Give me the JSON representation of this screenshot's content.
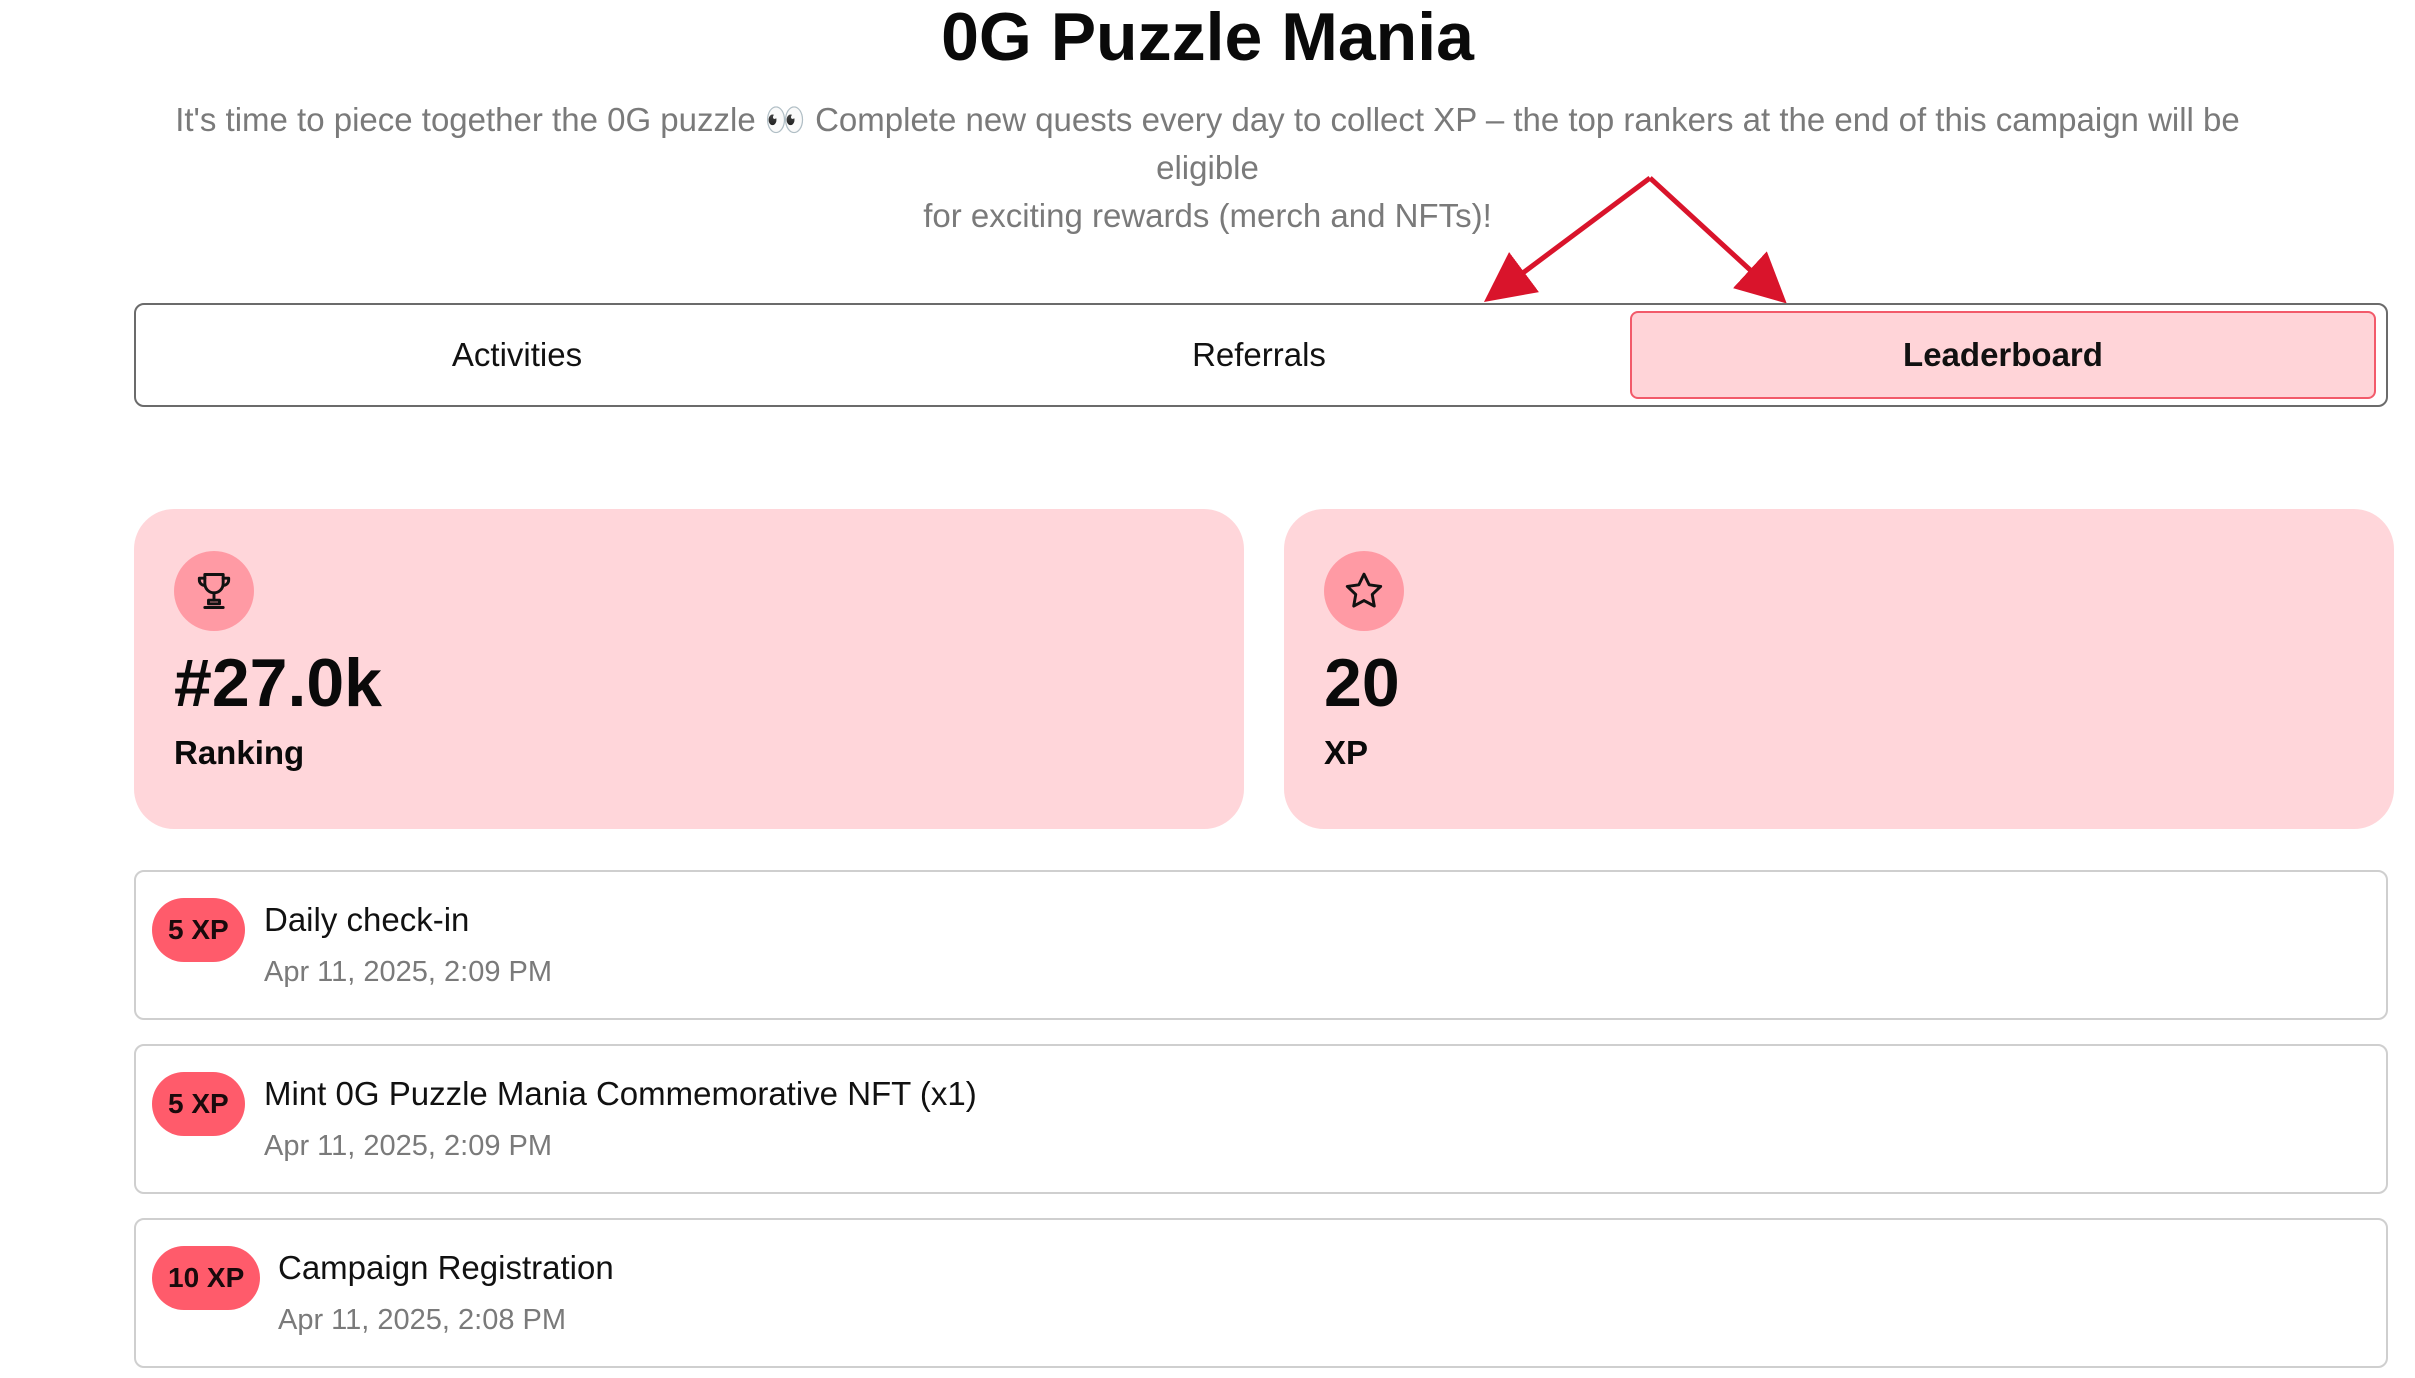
{
  "header": {
    "title": "0G Puzzle Mania",
    "subtitle_line1": "It's time to piece together the 0G puzzle 👀 Complete new quests every day to collect XP – the top rankers at the end of this campaign will be eligible",
    "subtitle_line2": "for exciting rewards (merch and NFTs)!"
  },
  "tabs": [
    {
      "label": "Activities",
      "active": false
    },
    {
      "label": "Referrals",
      "active": false
    },
    {
      "label": "Leaderboard",
      "active": true
    }
  ],
  "stats": {
    "ranking": {
      "icon": "trophy-icon",
      "value": "#27.0k",
      "label": "Ranking"
    },
    "xp": {
      "icon": "star-icon",
      "value": "20",
      "label": "XP"
    }
  },
  "activities": [
    {
      "badge": "5 XP",
      "title": "Daily check-in",
      "time": "Apr 11, 2025, 2:09 PM"
    },
    {
      "badge": "5 XP",
      "title": "Mint 0G Puzzle Mania Commemorative NFT (x1)",
      "time": "Apr 11, 2025, 2:09 PM"
    },
    {
      "badge": "10 XP",
      "title": "Campaign Registration",
      "time": "Apr 11, 2025, 2:08 PM"
    }
  ],
  "colors": {
    "accent": "#ff5b6b",
    "card_background": "#ffd6da",
    "annotation_arrow": "#d9142b"
  }
}
